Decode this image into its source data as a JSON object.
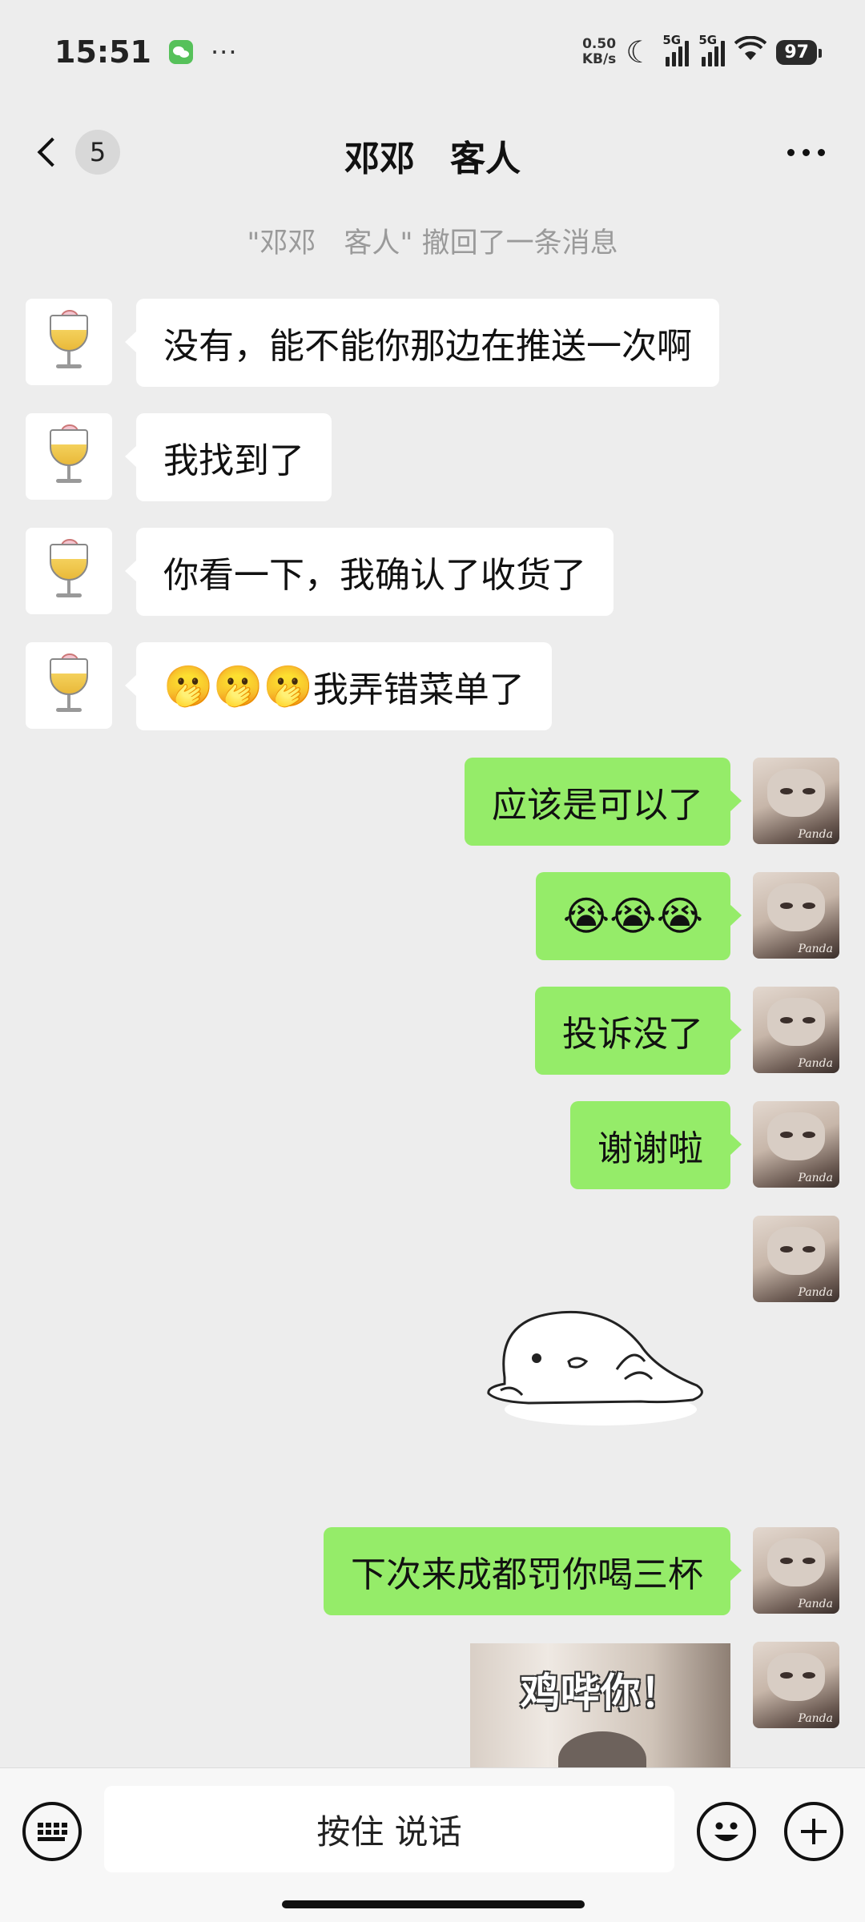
{
  "status_bar": {
    "time": "15:51",
    "dots": "···",
    "net_speed_value": "0.50",
    "net_speed_unit": "KB/s",
    "sim1": "5G",
    "sim2": "5G",
    "battery": "97"
  },
  "nav": {
    "unread_count": "5",
    "title": "邓邓　客人"
  },
  "system_notice": "\"邓邓　客人\" 撤回了一条消息",
  "messages": [
    {
      "side": "in",
      "text": "没有，能不能你那边在推送一次啊"
    },
    {
      "side": "in",
      "text": "我找到了"
    },
    {
      "side": "in",
      "text": "你看一下，我确认了收货了"
    },
    {
      "side": "in",
      "emoji": "🫢🫢🫢",
      "text": "我弄错菜单了"
    },
    {
      "side": "out",
      "text": "应该是可以了"
    },
    {
      "side": "out",
      "emoji": "😭😭😭"
    },
    {
      "side": "out",
      "text": "投诉没了"
    },
    {
      "side": "out",
      "text": "谢谢啦"
    },
    {
      "side": "out",
      "type": "sticker"
    },
    {
      "side": "out",
      "text": "下次来成都罚你喝三杯"
    },
    {
      "side": "out",
      "type": "image",
      "caption": "鸡哔你！"
    }
  ],
  "avatar_out_label": "Panda",
  "input_bar": {
    "hold_to_talk": "按住 说话"
  },
  "colors": {
    "background": "#ededed",
    "bubble_out": "#95ec69",
    "bubble_in": "#ffffff",
    "notice_text": "#9a9a9a"
  }
}
